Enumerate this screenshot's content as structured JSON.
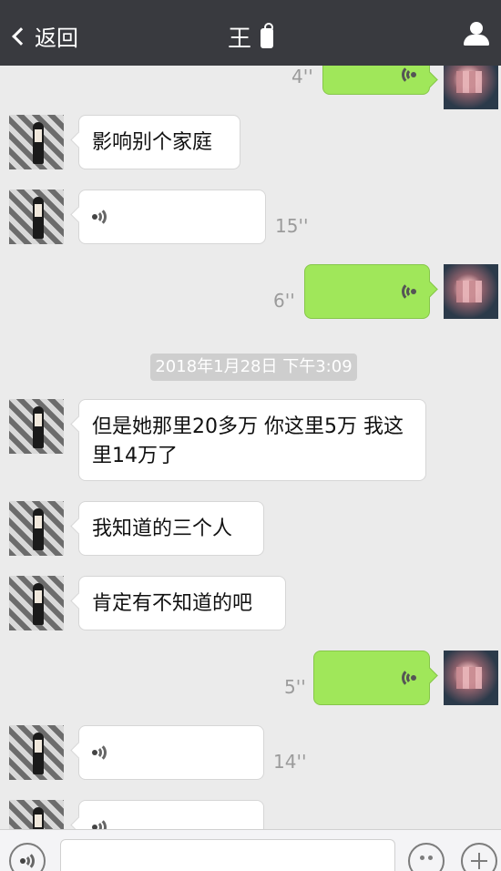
{
  "header": {
    "back_label": "返回",
    "title": "王"
  },
  "messages": [
    {
      "side": "right",
      "type": "voice",
      "duration": "4''"
    },
    {
      "side": "left",
      "type": "text",
      "text": "影响别个家庭"
    },
    {
      "side": "left",
      "type": "voice",
      "duration": "15''"
    },
    {
      "side": "right",
      "type": "voice",
      "duration": "6''"
    },
    {
      "type": "timestamp",
      "text": "2018年1月28日 下午3:09"
    },
    {
      "side": "left",
      "type": "text",
      "text": "但是她那里20多万 你这里5万 我这里14万了"
    },
    {
      "side": "left",
      "type": "text",
      "text": "我知道的三个人"
    },
    {
      "side": "left",
      "type": "text",
      "text": "肯定有不知道的吧"
    },
    {
      "side": "right",
      "type": "voice",
      "duration": "5''"
    },
    {
      "side": "left",
      "type": "voice",
      "duration": "14''"
    },
    {
      "side": "left",
      "type": "voice",
      "duration": ""
    }
  ],
  "icons": {
    "back": "chevron-left-icon",
    "profile": "user-icon",
    "voice": "voice-wave-icon",
    "emoji": "emoji-icon",
    "plus": "plus-icon"
  },
  "colors": {
    "header_bg": "#393a3f",
    "chat_bg": "#ebebeb",
    "outgoing_bubble": "#a0e75a",
    "incoming_bubble": "#ffffff"
  }
}
